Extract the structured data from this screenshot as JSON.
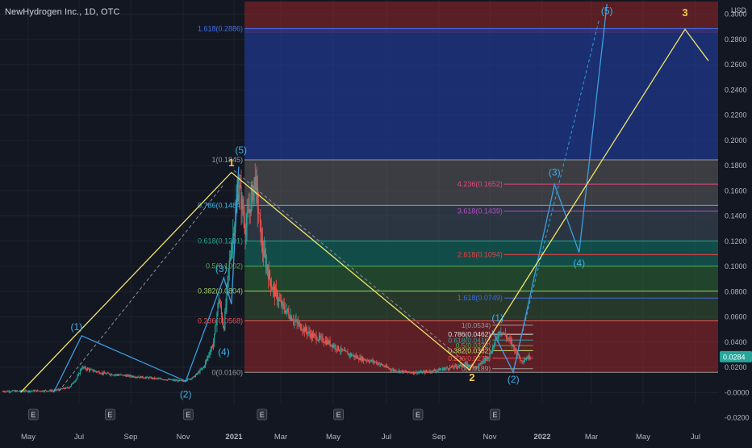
{
  "header": {
    "symbol_title": "NewHydrogen Inc., 1D, OTC"
  },
  "chart_data": {
    "type": "candlestick",
    "currency": "USD",
    "y_axis": {
      "range": [
        -0.02,
        0.3
      ],
      "ticks": [
        "0.3000",
        "0.2800",
        "0.2600",
        "0.2400",
        "0.2200",
        "0.2000",
        "0.1800",
        "0.1600",
        "0.1400",
        "0.1200",
        "0.1000",
        "0.0800",
        "0.0600",
        "0.0400",
        "0.0200",
        "-0.0000",
        "-0.0200"
      ]
    },
    "x_axis": {
      "labels": [
        {
          "t": 0.0,
          "label": "May",
          "bold": false
        },
        {
          "t": 2.0,
          "label": "Jul",
          "bold": false
        },
        {
          "t": 4.0,
          "label": "Sep",
          "bold": false
        },
        {
          "t": 6.0,
          "label": "Nov",
          "bold": false
        },
        {
          "t": 8.0,
          "label": "2021",
          "bold": true
        },
        {
          "t": 10.0,
          "label": "Mar",
          "bold": false
        },
        {
          "t": 12.0,
          "label": "May",
          "bold": false
        },
        {
          "t": 14.0,
          "label": "Jul",
          "bold": false
        },
        {
          "t": 16.0,
          "label": "Sep",
          "bold": false
        },
        {
          "t": 18.0,
          "label": "Nov",
          "bold": false
        },
        {
          "t": 20.0,
          "label": "2022",
          "bold": true
        },
        {
          "t": 22.0,
          "label": "Mar",
          "bold": false
        },
        {
          "t": 24.0,
          "label": "May",
          "bold": false
        },
        {
          "t": 26.0,
          "label": "Jul",
          "bold": false
        }
      ]
    },
    "earnings_markers": {
      "label": "E",
      "t": [
        0.2,
        3.2,
        6.2,
        9.2,
        12.2,
        15.2,
        18.2
      ]
    },
    "last_price": {
      "value": 0.0284,
      "label": "0.0284"
    },
    "price_series": [
      {
        "t": -1.0,
        "v": 0.001
      },
      {
        "t": 0.0,
        "v": 0.0012
      },
      {
        "t": 1.0,
        "v": 0.0015
      },
      {
        "t": 1.6,
        "v": 0.004
      },
      {
        "t": 1.9,
        "v": 0.011
      },
      {
        "t": 2.1,
        "v": 0.02
      },
      {
        "t": 2.4,
        "v": 0.018
      },
      {
        "t": 3.0,
        "v": 0.015
      },
      {
        "t": 4.0,
        "v": 0.013
      },
      {
        "t": 5.0,
        "v": 0.011
      },
      {
        "t": 6.0,
        "v": 0.009
      },
      {
        "t": 6.4,
        "v": 0.012
      },
      {
        "t": 6.8,
        "v": 0.02
      },
      {
        "t": 7.2,
        "v": 0.04
      },
      {
        "t": 7.4,
        "v": 0.075
      },
      {
        "t": 7.6,
        "v": 0.05
      },
      {
        "t": 7.8,
        "v": 0.1
      },
      {
        "t": 8.2,
        "v": 0.165
      },
      {
        "t": 8.5,
        "v": 0.13
      },
      {
        "t": 8.9,
        "v": 0.17
      },
      {
        "t": 9.2,
        "v": 0.115
      },
      {
        "t": 9.6,
        "v": 0.085
      },
      {
        "t": 10.0,
        "v": 0.07
      },
      {
        "t": 10.6,
        "v": 0.055
      },
      {
        "t": 11.2,
        "v": 0.045
      },
      {
        "t": 11.8,
        "v": 0.04
      },
      {
        "t": 12.4,
        "v": 0.032
      },
      {
        "t": 13.0,
        "v": 0.027
      },
      {
        "t": 13.6,
        "v": 0.024
      },
      {
        "t": 14.2,
        "v": 0.018
      },
      {
        "t": 14.8,
        "v": 0.016
      },
      {
        "t": 15.4,
        "v": 0.016
      },
      {
        "t": 16.0,
        "v": 0.018
      },
      {
        "t": 16.5,
        "v": 0.02
      },
      {
        "t": 17.0,
        "v": 0.022
      },
      {
        "t": 17.5,
        "v": 0.02
      },
      {
        "t": 18.0,
        "v": 0.03
      },
      {
        "t": 18.4,
        "v": 0.05
      },
      {
        "t": 18.8,
        "v": 0.04
      },
      {
        "t": 19.2,
        "v": 0.025
      },
      {
        "t": 19.5,
        "v": 0.0284
      }
    ],
    "fib_zones": [
      {
        "from": 0.285,
        "to": 0.31,
        "color": "#a8282a",
        "opacity": 0.48
      },
      {
        "from": 0.1845,
        "to": 0.2886,
        "color": "#1e3ea0",
        "opacity": 0.62
      },
      {
        "from": 0.1484,
        "to": 0.1845,
        "color": "#6d6d6d",
        "opacity": 0.45
      },
      {
        "from": 0.1201,
        "to": 0.1484,
        "color": "#4a5a6a",
        "opacity": 0.45
      },
      {
        "from": 0.1002,
        "to": 0.1201,
        "color": "#12786a",
        "opacity": 0.55
      },
      {
        "from": 0.0804,
        "to": 0.1002,
        "color": "#2e6a36",
        "opacity": 0.55
      },
      {
        "from": 0.0568,
        "to": 0.0804,
        "color": "#3a5a32",
        "opacity": 0.5
      },
      {
        "from": 0.016,
        "to": 0.0568,
        "color": "#a8282a",
        "opacity": 0.5
      }
    ],
    "fib_levels": [
      {
        "value": 0.2886,
        "label": "1.618(0.2886)",
        "color": "#3f6ff0"
      },
      {
        "value": 0.1845,
        "label": "1(0.1845)",
        "color": "#9a9a9a"
      },
      {
        "value": 0.1484,
        "label": "0.786(0.1484)",
        "color": "#3eb8e8"
      },
      {
        "value": 0.1201,
        "label": "0.618(0.1201)",
        "color": "#1fa48e"
      },
      {
        "value": 0.1002,
        "label": "0.5(0.1002)",
        "color": "#4caf50"
      },
      {
        "value": 0.0804,
        "label": "0.382(0.0804)",
        "color": "#9ccc65"
      },
      {
        "value": 0.0568,
        "label": "0.236(0.0568)",
        "color": "#f05050"
      },
      {
        "value": 0.016,
        "label": "0(0.0160)",
        "color": "#9a9a9a"
      }
    ],
    "extension_levels": [
      {
        "value": 0.1652,
        "label": "4.236(0.1652)",
        "color": "#e8457a"
      },
      {
        "value": 0.1439,
        "label": "3.618(0.1439)",
        "color": "#b04fc0"
      },
      {
        "value": 0.1094,
        "label": "2.618(0.1094)",
        "color": "#e84040"
      },
      {
        "value": 0.0749,
        "label": "1.618(0.0749)",
        "color": "#3a6fe0"
      }
    ],
    "small_fib_levels": [
      {
        "value": 0.0534,
        "label": "1(0.0534)",
        "color": "#9a9a9a"
      },
      {
        "value": 0.0462,
        "label": "0.786(0.0462)",
        "color": "#e0e0e0"
      },
      {
        "value": 0.0416,
        "label": "0.618(0.0416)",
        "color": "#26a69a"
      },
      {
        "value": 0.0372,
        "label": "0.5(0.0372)",
        "color": "#4caf50"
      },
      {
        "value": 0.0332,
        "label": "0.382(0.0332)",
        "color": "#c8e06a"
      },
      {
        "value": 0.0272,
        "label": "0.236(0.0272)",
        "color": "#f05050"
      },
      {
        "value": 0.0189,
        "label": "0(0.0189)",
        "color": "#9a9a9a"
      }
    ],
    "yellow_waves": [
      {
        "t": -0.3,
        "v": 0.0
      },
      {
        "t": 7.9,
        "v": 0.1745
      },
      {
        "t": 17.2,
        "v": 0.018
      },
      {
        "t": 25.6,
        "v": 0.288
      },
      {
        "t": 26.5,
        "v": 0.263
      }
    ],
    "blue_impulse_1": [
      {
        "t": 1.0,
        "v": 0.0
      },
      {
        "t": 2.1,
        "v": 0.045
      },
      {
        "t": 6.1,
        "v": 0.009
      },
      {
        "t": 7.6,
        "v": 0.091
      },
      {
        "t": 7.9,
        "v": 0.07
      },
      {
        "t": 8.2,
        "v": 0.179
      }
    ],
    "blue_impulse_2": [
      {
        "t": 18.1,
        "v": 0.049
      },
      {
        "t": 18.9,
        "v": 0.016
      },
      {
        "t": 20.5,
        "v": 0.165
      },
      {
        "t": 21.5,
        "v": 0.111
      },
      {
        "t": 22.6,
        "v": 0.308
      }
    ],
    "dashed_lines": [
      [
        {
          "t": 1.2,
          "v": 0.001
        },
        {
          "t": 7.6,
          "v": 0.165
        }
      ],
      [
        {
          "t": 8.0,
          "v": 0.176
        },
        {
          "t": 17.3,
          "v": 0.02
        }
      ],
      [
        {
          "t": 18.9,
          "v": 0.018
        },
        {
          "t": 22.3,
          "v": 0.296
        }
      ]
    ],
    "wave_labels": [
      {
        "text": "(1)",
        "t": 1.9,
        "v": 0.0495,
        "color": "#3eb1e8"
      },
      {
        "text": "(2)",
        "t": 6.1,
        "v": -0.004,
        "color": "#3eb1e8"
      },
      {
        "text": "(3)",
        "t": 7.5,
        "v": 0.0955,
        "color": "#3eb1e8"
      },
      {
        "text": "(4)",
        "t": 7.6,
        "v": 0.0295,
        "color": "#3eb1e8"
      },
      {
        "text": "(5)",
        "t": 8.3,
        "v": 0.1895,
        "color": "#3eb1e8"
      },
      {
        "text": "1",
        "t": 7.9,
        "v": 0.1795,
        "color": "#f5c84a"
      },
      {
        "text": "2",
        "t": 17.3,
        "v": 0.009,
        "color": "#f5c84a"
      },
      {
        "text": "3",
        "t": 25.6,
        "v": 0.2985,
        "color": "#f5c84a"
      },
      {
        "text": "(1)",
        "t": 18.3,
        "v": 0.0565,
        "color": "#3eb1e8"
      },
      {
        "text": "(2)",
        "t": 18.9,
        "v": 0.008,
        "color": "#3eb1e8"
      },
      {
        "text": "(3)",
        "t": 20.5,
        "v": 0.172,
        "color": "#3eb1e8"
      },
      {
        "text": "(4)",
        "t": 21.5,
        "v": 0.1,
        "color": "#3eb1e8"
      },
      {
        "text": "(5)",
        "t": 22.6,
        "v": 0.3,
        "color": "#3eb1e8"
      }
    ]
  }
}
